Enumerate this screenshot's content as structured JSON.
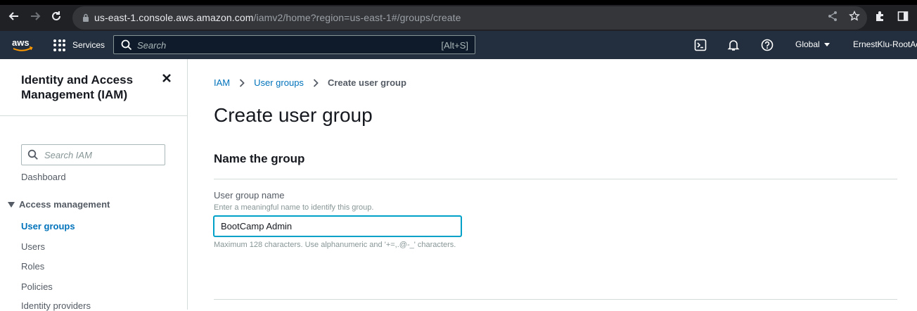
{
  "browser": {
    "url_host": "us-east-1.console.aws.amazon.com",
    "url_path": "/iamv2/home?region=us-east-1#/groups/create"
  },
  "topnav": {
    "services_label": "Services",
    "search_placeholder": "Search",
    "search_shortcut": "[Alt+S]",
    "region_label": "Global",
    "account_label": "ErnestKlu-RootAc"
  },
  "sidebar": {
    "title": "Identity and Access Management (IAM)",
    "search_placeholder": "Search IAM",
    "dashboard_label": "Dashboard",
    "section_label": "Access management",
    "items": [
      {
        "label": "User groups",
        "active": true
      },
      {
        "label": "Users",
        "active": false
      },
      {
        "label": "Roles",
        "active": false
      },
      {
        "label": "Policies",
        "active": false
      },
      {
        "label": "Identity providers",
        "active": false
      }
    ]
  },
  "breadcrumb": {
    "items": [
      "IAM",
      "User groups",
      "Create user group"
    ]
  },
  "main": {
    "page_title": "Create user group",
    "section_title": "Name the group",
    "field_label": "User group name",
    "field_description": "Enter a meaningful name to identify this group.",
    "field_value": "BootCamp Admin",
    "field_constraint": "Maximum 128 characters. Use alphanumeric and '+=,.@-_' characters."
  },
  "colors": {
    "aws_nav_bg": "#232f3e",
    "link_blue": "#0073bb",
    "focus_blue": "#00a1c9",
    "aws_orange": "#ff9900"
  }
}
